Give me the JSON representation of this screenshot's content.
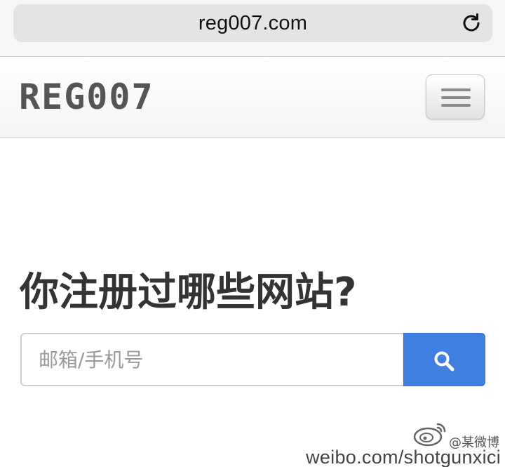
{
  "browser": {
    "url": "reg007.com"
  },
  "navbar": {
    "logo": "REG007"
  },
  "main": {
    "headline": "你注册过哪些网站?",
    "search": {
      "placeholder": "邮箱/手机号",
      "value": ""
    }
  },
  "watermark": {
    "name": "@某微博",
    "url": "weibo.com/shotgunxici"
  },
  "icons": {
    "reload": "reload-icon",
    "menu": "hamburger-menu-icon",
    "search": "search-icon",
    "weibo": "weibo-logo-icon"
  },
  "colors": {
    "search_button": "#3f7fe0",
    "logo_text": "#555555",
    "headline_text": "#333333"
  }
}
